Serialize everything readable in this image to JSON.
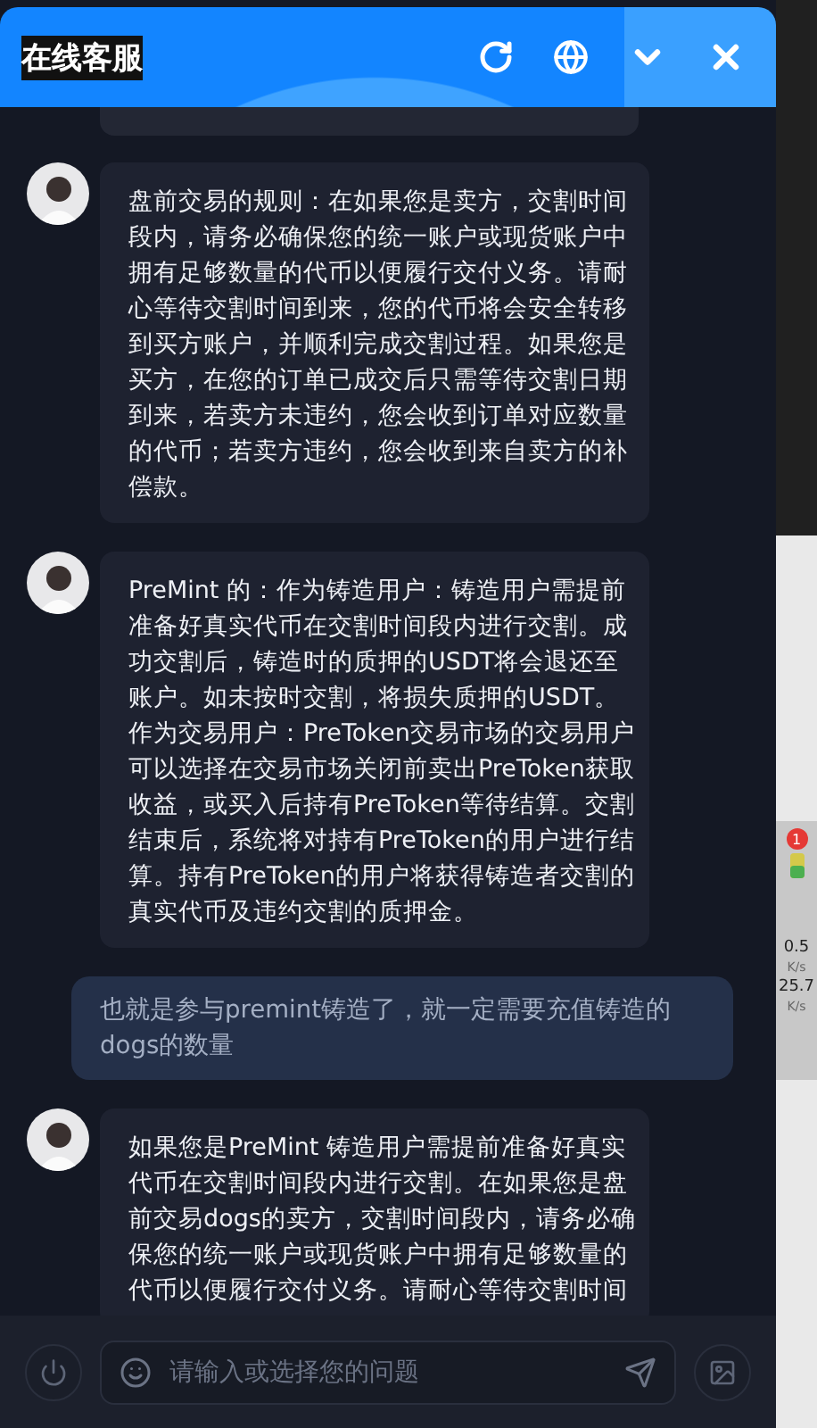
{
  "header": {
    "title": "在线客服"
  },
  "messages": [
    {
      "kind": "cut"
    },
    {
      "kind": "bot",
      "text": "盘前交易的规则：在如果您是卖方，交割时间段内，请务必确保您的统一账户或现货账户中拥有足够数量的代币以便履行交付义务。请耐心等待交割时间到来，您的代币将会安全转移到买方账户，并顺利完成交割过程。如果您是买方，在您的订单已成交后只需等待交割日期到来，若卖方未违约，您会收到订单对应数量的代币；若卖方违约，您会收到来自卖方的补偿款。"
    },
    {
      "kind": "bot",
      "text": "PreMint 的：作为铸造用户：铸造用户需提前准备好真实代币在交割时间段内进行交割。成功交割后，铸造时的质押的USDT将会退还至账户。如未按时交割，将损失质押的USDT。作为交易用户：PreToken交易市场的交易用户可以选择在交易市场关闭前卖出PreToken获取收益，或买入后持有PreToken等待结算。交割结束后，系统将对持有PreToken的用户进行结算。持有PreToken的用户将获得铸造者交割的真实代币及违约交割的质押金。"
    },
    {
      "kind": "user",
      "text": "也就是参与premint铸造了，就一定需要充值铸造的dogs的数量"
    },
    {
      "kind": "bot",
      "text": "如果您是PreMint 铸造用户需提前准备好真实代币在交割时间段内进行交割。在如果您是盘前交易dogs的卖方，交割时间段内，请务必确保您的统一账户或现货账户中拥有足够数量的代币以便履行交付义务。请耐心等待交割时间"
    }
  ],
  "input": {
    "placeholder": "请输入或选择您的问题"
  },
  "side_widget": {
    "badge": "1",
    "upload": "0.5",
    "upload_unit": "K/s",
    "download": "25.7",
    "download_unit": "K/s"
  }
}
